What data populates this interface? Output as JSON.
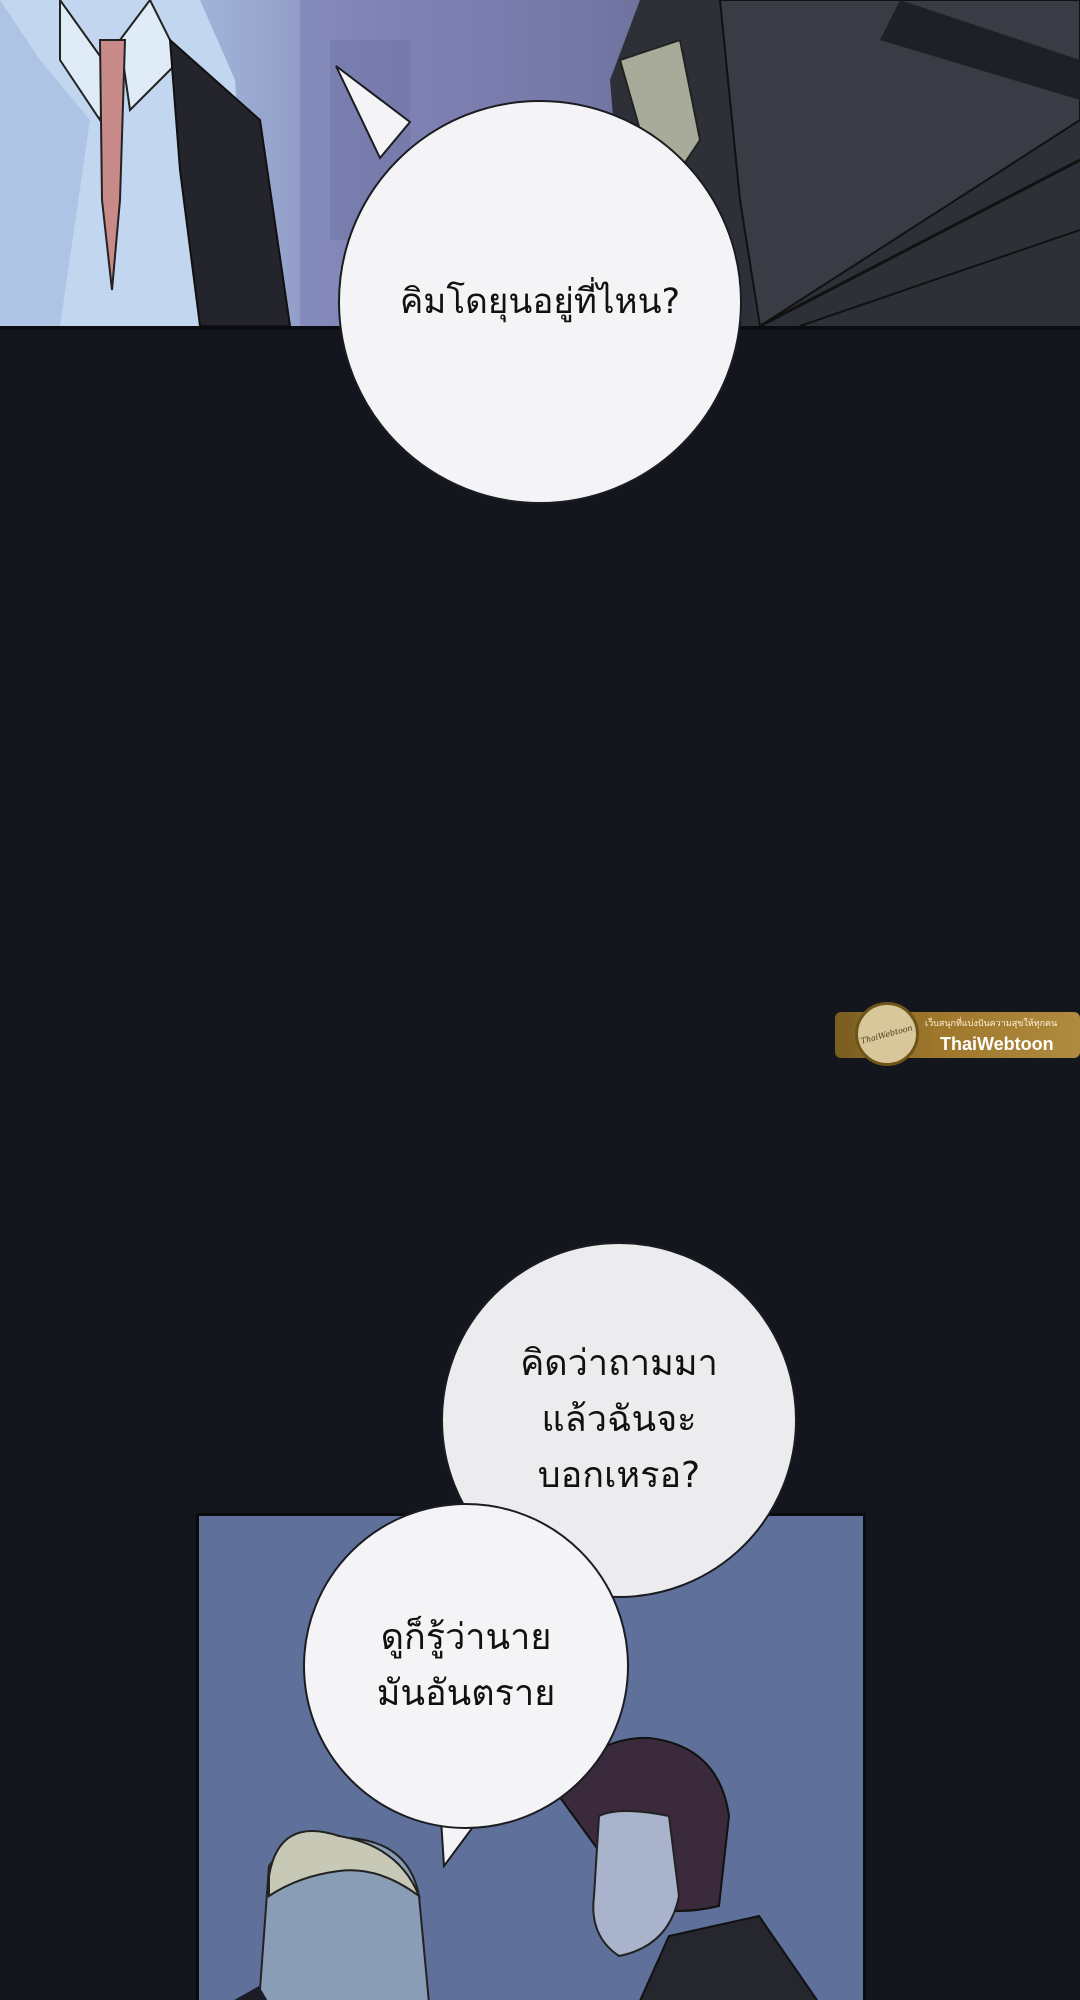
{
  "colors": {
    "background": "#14161e",
    "bubble_fill": "#f4f4f6",
    "watermark_gold": "#b6872e"
  },
  "bubbles": [
    {
      "text": "คิมโดยุนอยู่ที่ไหน?"
    },
    {
      "text": "คิดว่าถามมา\nแล้วฉันจะ\nบอกเหรอ?"
    },
    {
      "text": "ดูก็รู้ว่านาย\nมันอันตราย"
    }
  ],
  "watermark": {
    "brand": "ThaiWebtoon",
    "tagline": "เว็บสนุกที่แบ่งปันความสุขให้ทุกคน",
    "logo_text": "ThaiWebtoon"
  }
}
